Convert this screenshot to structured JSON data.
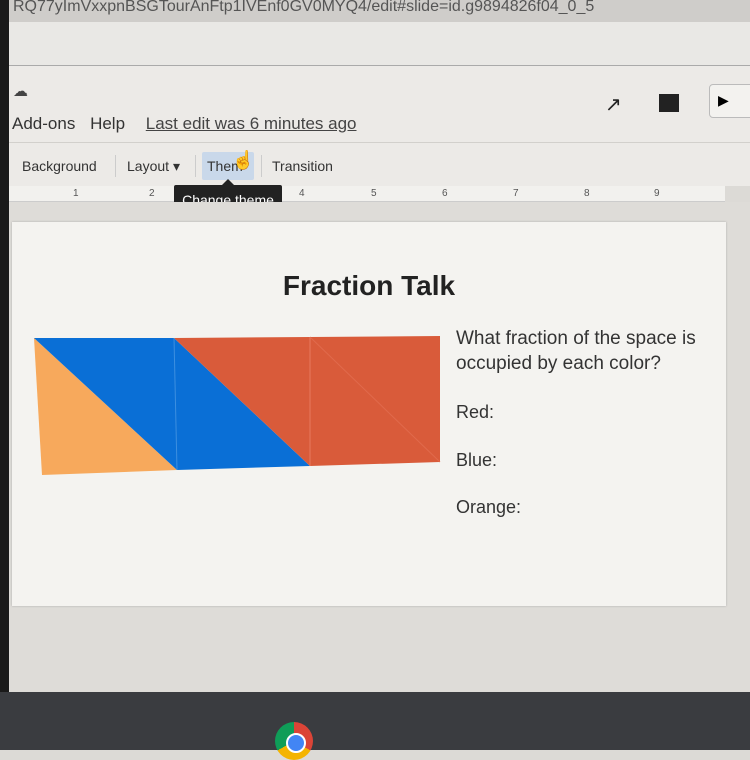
{
  "browser": {
    "url": "RQ77yImVxxpnBSGTourAnFtp1IVEnf0GV0MYQ4/edit#slide=id.g9894826f04_0_5"
  },
  "menu": {
    "items": [
      "Add-ons",
      "Help"
    ],
    "last_edit": "Last edit was 6 minutes ago"
  },
  "toolbar": {
    "background": "Background",
    "layout": "Layout",
    "theme": "Them",
    "transition": "Transition",
    "tooltip": "Change theme"
  },
  "ruler": [
    "1",
    "2",
    "4",
    "5",
    "6",
    "7",
    "8",
    "9"
  ],
  "slide": {
    "title": "Fraction Talk",
    "question": "What fraction of the space is occupied by each color?",
    "labels": [
      "Red:",
      "Blue:",
      "Orange:"
    ]
  },
  "colors": {
    "blue": "#0a6fd6",
    "red": "#d95b3a",
    "orange": "#f7a95c"
  },
  "icons": [
    "cloud-status-icon",
    "activity-icon",
    "comment-icon",
    "present-icon",
    "chrome-icon"
  ]
}
